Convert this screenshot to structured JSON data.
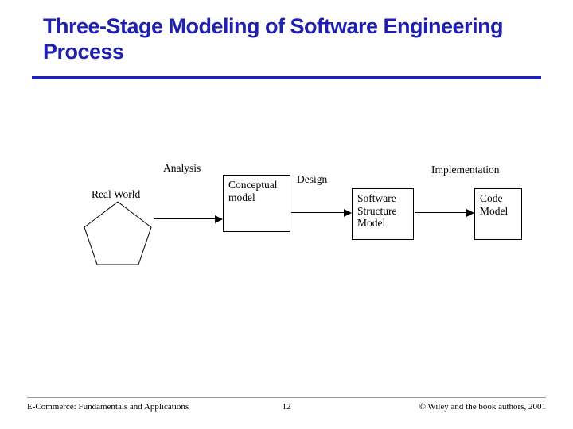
{
  "title": "Three-Stage Modeling of Software Engineering Process",
  "stages": {
    "analysis": "Analysis",
    "design": "Design",
    "implementation": "Implementation"
  },
  "nodes": {
    "real_world": "Real World",
    "conceptual_model": "Conceptual\nmodel",
    "software_structure_model": "Software\nStructure\nModel",
    "code_model": "Code\nModel"
  },
  "footer": {
    "left": "E-Commerce: Fundamentals and Applications",
    "page": "12",
    "right": "© Wiley and the book authors, 2001"
  }
}
